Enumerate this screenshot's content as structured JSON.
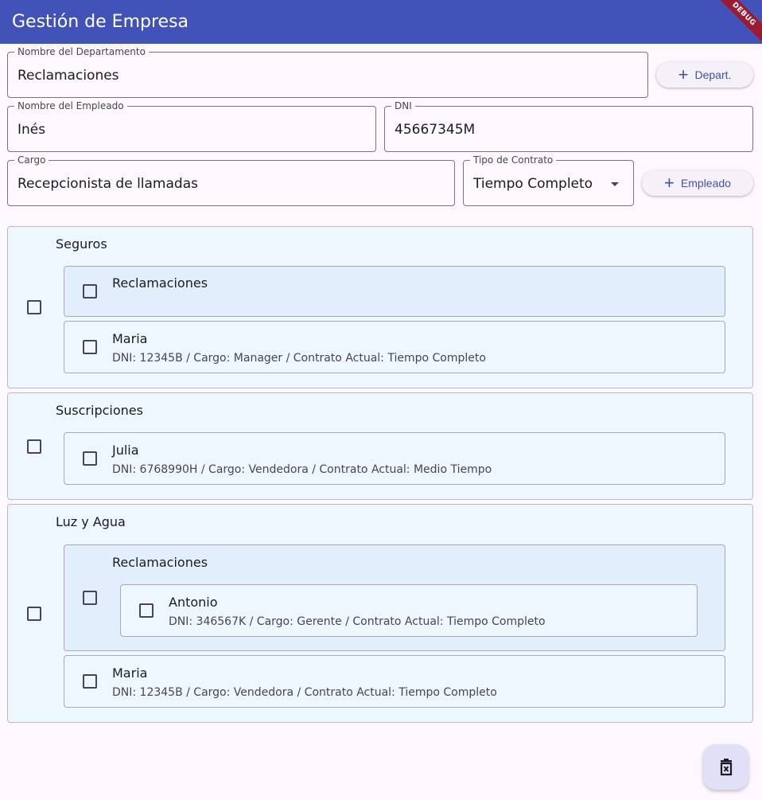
{
  "appbar": {
    "title": "Gestión de Empresa",
    "debug_label": "DEBUG"
  },
  "form": {
    "department_name": {
      "label": "Nombre del Departamento",
      "value": "Reclamaciones"
    },
    "add_department_button": "Depart.",
    "employee_name": {
      "label": "Nombre del Empleado",
      "value": "Inés"
    },
    "dni": {
      "label": "DNI",
      "value": "45667345M"
    },
    "position": {
      "label": "Cargo",
      "value": "Recepcionista de llamadas"
    },
    "contract_type": {
      "label": "Tipo de Contrato",
      "value": "Tiempo Completo"
    },
    "add_employee_button": "Empleado"
  },
  "departments": [
    {
      "name": "Seguros",
      "subdepartments": [
        {
          "name": "Reclamaciones"
        }
      ],
      "employees": [
        {
          "name": "Maria",
          "details": "DNI: 12345B / Cargo: Manager / Contrato Actual: Tiempo Completo"
        }
      ]
    },
    {
      "name": "Suscripciones",
      "employees": [
        {
          "name": "Julia",
          "details": "DNI: 6768990H / Cargo: Vendedora / Contrato Actual: Medio Tiempo"
        }
      ]
    },
    {
      "name": "Luz y Agua",
      "subdepartments": [
        {
          "name": "Reclamaciones",
          "employees": [
            {
              "name": "Antonio",
              "details": "DNI: 346567K / Cargo: Gerente / Contrato Actual: Tiempo Completo"
            }
          ]
        }
      ],
      "employees": [
        {
          "name": "Maria",
          "details": "DNI: 12345B / Cargo: Vendedora / Contrato Actual: Tiempo Completo"
        }
      ]
    }
  ],
  "fab": {
    "icon": "delete-sweep-icon"
  }
}
